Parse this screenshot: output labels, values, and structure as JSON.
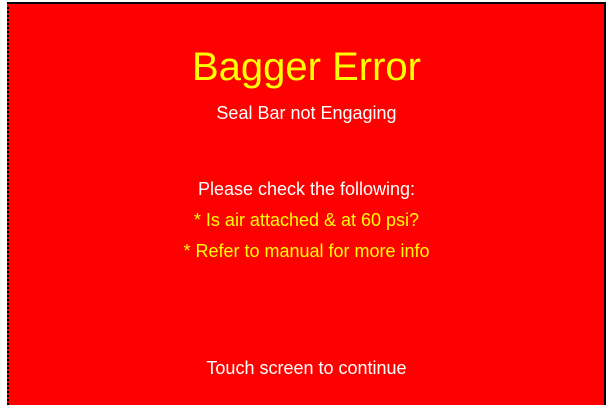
{
  "error_screen": {
    "title": "Bagger Error",
    "subtitle": "Seal Bar not Engaging",
    "check_heading": "Please check the following:",
    "check_items": [
      "* Is air attached & at 60 psi?",
      "* Refer to manual for more info"
    ],
    "continue_prompt": "Touch screen to continue"
  },
  "colors": {
    "background": "#ff0000",
    "title_text": "#ffff00",
    "body_text": "#ffffff",
    "check_item_text": "#ffff00"
  }
}
